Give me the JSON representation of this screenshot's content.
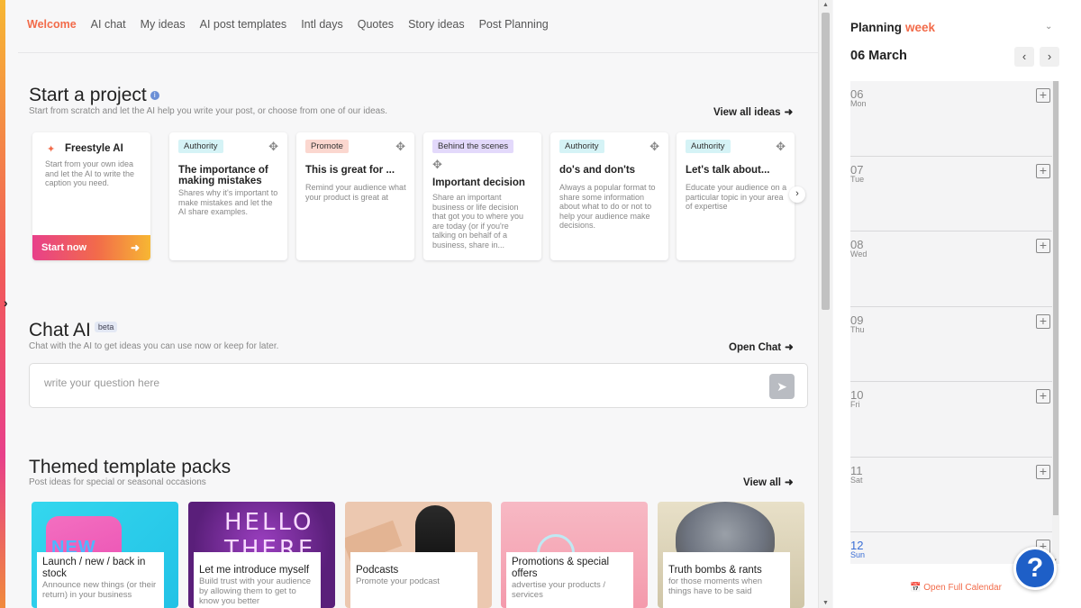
{
  "nav": {
    "items": [
      "Welcome",
      "AI chat",
      "My ideas",
      "AI post templates",
      "Intl days",
      "Quotes",
      "Story ideas",
      "Post Planning"
    ],
    "active": "Welcome"
  },
  "project": {
    "title": "Start a project",
    "subtitle": "Start from scratch and let the AI help you write your post, or choose from one of our ideas.",
    "view_all": "View all ideas",
    "freestyle": {
      "title": "Freestyle AI",
      "desc": "Start from your own idea and let the AI to write the caption you need.",
      "button": "Start now"
    },
    "cards": [
      {
        "tag": "Authority",
        "title": "The importance of making mistakes",
        "desc": "Shares why it's important to make mistakes and let the AI share examples."
      },
      {
        "tag": "Promote",
        "title": "This is great for ...",
        "desc": "Remind your audience what your product is great at"
      },
      {
        "tag": "Behind the scenes",
        "title": "Important decision",
        "desc": "Share an important business or life decision that got you to where you are today (or if you're talking on behalf of a business, share in..."
      },
      {
        "tag": "Authority",
        "title": "do's and don'ts",
        "desc": "Always a popular format to share some information about what to do or not to help your audience make decisions."
      },
      {
        "tag": "Authority",
        "title": "Let's talk about...",
        "desc": "Educate your audience on a particular topic in your area of expertise"
      }
    ]
  },
  "chat": {
    "title": "Chat AI",
    "badge": "beta",
    "subtitle": "Chat with the AI to get ideas you can use now or keep for later.",
    "open": "Open Chat",
    "placeholder": "write your question here"
  },
  "packs": {
    "title": "Themed template packs",
    "subtitle": "Post ideas for special or seasonal occasions",
    "view_all": "View all",
    "items": [
      {
        "title": "Launch / new / back in stock",
        "desc": "Announce new things (or their return) in your business"
      },
      {
        "title": "Let me introduce myself",
        "desc": "Build trust with your audience by allowing them to get to know you better"
      },
      {
        "title": "Podcasts",
        "desc": "Promote your podcast"
      },
      {
        "title": "Promotions & special offers",
        "desc": "advertise your products / services"
      },
      {
        "title": "Truth bombs & rants",
        "desc": "for those moments when things have to be said"
      }
    ],
    "image_texts": {
      "new": "NEW",
      "hello": "HELLO THERE"
    }
  },
  "planner": {
    "label": "Planning",
    "period": "week",
    "date": "06 March",
    "days": [
      {
        "num": "06",
        "dow": "Mon"
      },
      {
        "num": "07",
        "dow": "Tue"
      },
      {
        "num": "08",
        "dow": "Wed"
      },
      {
        "num": "09",
        "dow": "Thu"
      },
      {
        "num": "10",
        "dow": "Fri"
      },
      {
        "num": "11",
        "dow": "Sat"
      },
      {
        "num": "12",
        "dow": "Sun"
      }
    ],
    "open_calendar": "Open Full Calendar"
  },
  "help": "?",
  "colors": {
    "accent": "#f26b4a",
    "help": "#1e5fc7",
    "sunday": "#3b6fd6"
  },
  "icons": [
    "info-icon",
    "move-icon",
    "wand-icon",
    "arrow-right-icon",
    "chevron-right-icon",
    "send-icon",
    "add-icon",
    "calendar-icon",
    "help-icon"
  ]
}
